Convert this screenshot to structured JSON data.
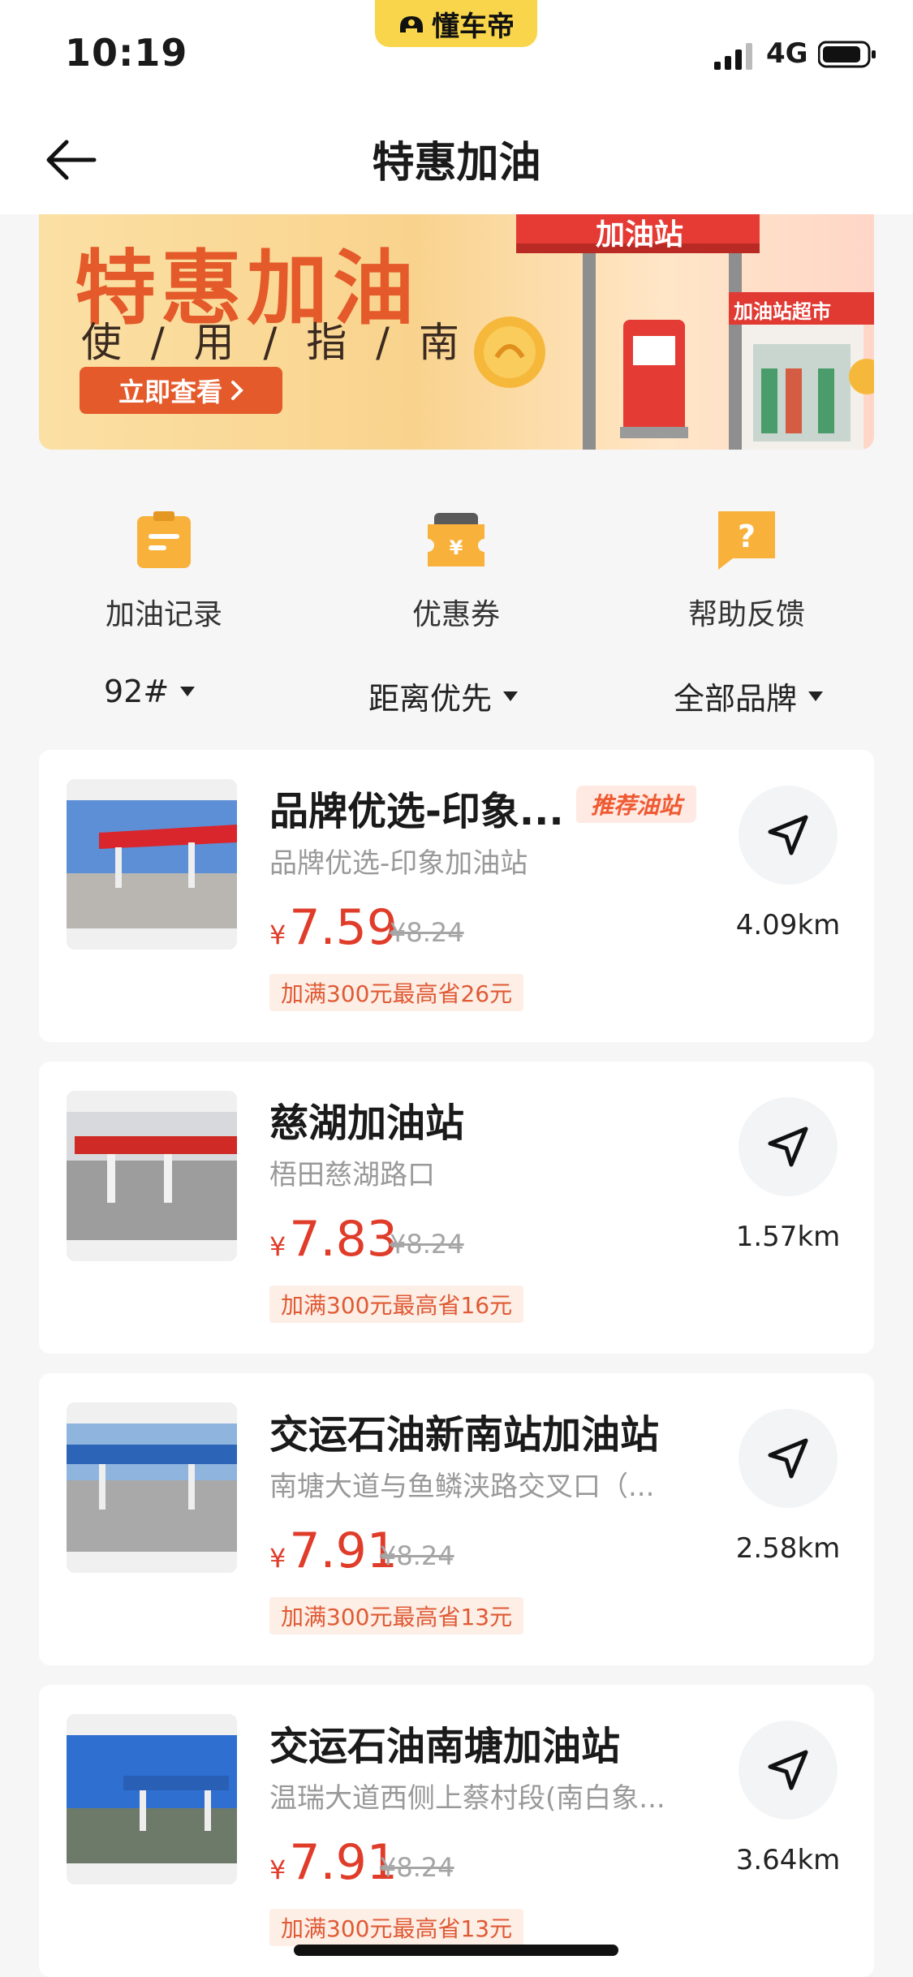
{
  "status_bar": {
    "time": "10:19",
    "app_badge": "懂车帝",
    "network": "4G"
  },
  "header": {
    "title": "特惠加油"
  },
  "banner": {
    "title": "特惠加油",
    "subtitle": "使 / 用 / 指 / 南",
    "button": "立即查看",
    "sign_station": "加油站",
    "sign_shop": "加油站超市"
  },
  "quick_actions": [
    {
      "label": "加油记录",
      "icon": "record-icon"
    },
    {
      "label": "优惠券",
      "icon": "coupon-icon"
    },
    {
      "label": "帮助反馈",
      "icon": "help-icon"
    }
  ],
  "filters": {
    "fuel": "92#",
    "sort": "距离优先",
    "brand": "全部品牌"
  },
  "stations": [
    {
      "name": "品牌优选-印象...",
      "tag": "推荐油站",
      "address": "品牌优选-印象加油站",
      "currency": "¥",
      "price": "7.59",
      "original_price": "¥8.24",
      "promo": "加满300元最高省26元",
      "distance": "4.09km",
      "colors": {
        "canopy": "#d8262c",
        "sky": "#5d8fd6"
      }
    },
    {
      "name": "慈湖加油站",
      "tag": "",
      "address": "梧田慈湖路口",
      "currency": "¥",
      "price": "7.83",
      "original_price": "¥8.24",
      "promo": "加满300元最高省16元",
      "distance": "1.57km",
      "colors": {
        "canopy": "#cf2a25",
        "sky": "#d7d9dc"
      }
    },
    {
      "name": "交运石油新南站加油站",
      "tag": "",
      "address": "南塘大道与鱼鳞浃路交叉口（...",
      "currency": "¥",
      "price": "7.91",
      "original_price": "¥8.24",
      "promo": "加满300元最高省13元",
      "distance": "2.58km",
      "colors": {
        "canopy": "#2c64b8",
        "sky": "#8fb4dd"
      }
    },
    {
      "name": "交运石油南塘加油站",
      "tag": "",
      "address": "温瑞大道西侧上蔡村段(南白象...",
      "currency": "¥",
      "price": "7.91",
      "original_price": "¥8.24",
      "promo": "加满300元最高省13元",
      "distance": "3.64km",
      "colors": {
        "canopy": "#2a5fb6",
        "sky": "#2f6fd0"
      }
    }
  ]
}
